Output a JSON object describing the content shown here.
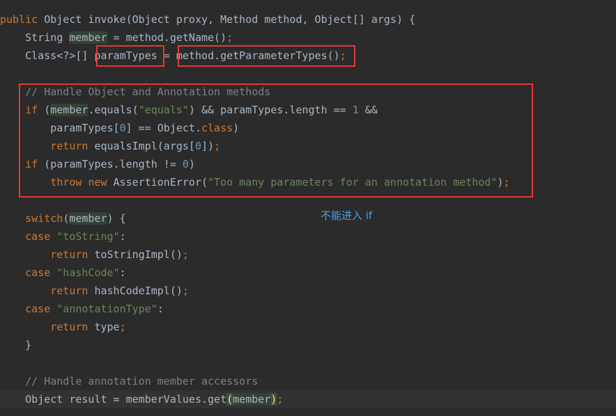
{
  "code": {
    "line1": {
      "kw": "public",
      "text": " Object invoke(Object proxy, Method method, Object[] args) {"
    },
    "line2": {
      "indent": "    ",
      "pre": "String ",
      "member": "member",
      "mid": " = method.getName()",
      "semi": ";"
    },
    "line3": {
      "indent": "    ",
      "pre": "Class<?>[] ",
      "var": "paramTypes",
      "eq": " = ",
      "call": "method.getParameterTypes()",
      "semi": ";"
    },
    "line5": {
      "indent": "    ",
      "comment": "// Handle Object and Annotation methods"
    },
    "line6": {
      "indent": "    ",
      "kw": "if",
      "open": " (",
      "member": "member",
      "call": ".equals(",
      "str": "\"equals\"",
      "rest": ") && paramTypes.length == ",
      "num": "1",
      "tail": " &&"
    },
    "line7": {
      "indent": "        ",
      "pre": "paramTypes[",
      "num": "0",
      "mid": "] == Object.",
      "kw": "class",
      "close": ")"
    },
    "line8": {
      "indent": "        ",
      "kw": "return",
      "mid": " equalsImpl(args[",
      "num": "0",
      "close": "])",
      "semi": ";"
    },
    "line9": {
      "indent": "    ",
      "kw": "if",
      "mid": " (paramTypes.length != ",
      "num": "0",
      "close": ")"
    },
    "line10": {
      "indent": "        ",
      "kw1": "throw",
      "sp": " ",
      "kw2": "new",
      "mid": " AssertionError(",
      "str": "\"Too many parameters for an annotation method\"",
      "close": ")",
      "semi": ";"
    },
    "line12": {
      "indent": "    ",
      "kw": "switch",
      "open": "(",
      "member": "member",
      "close": ") {"
    },
    "line13": {
      "indent": "    ",
      "kw": "case",
      "sp": " ",
      "str": "\"toString\"",
      "colon": ":"
    },
    "line14": {
      "indent": "        ",
      "kw": "return",
      "mid": " toStringImpl()",
      "semi": ";"
    },
    "line15": {
      "indent": "    ",
      "kw": "case",
      "sp": " ",
      "str": "\"hashCode\"",
      "colon": ":"
    },
    "line16": {
      "indent": "        ",
      "kw": "return",
      "mid": " hashCodeImpl()",
      "semi": ";"
    },
    "line17": {
      "indent": "    ",
      "kw": "case",
      "sp": " ",
      "str": "\"annotationType\"",
      "colon": ":"
    },
    "line18": {
      "indent": "        ",
      "kw": "return",
      "mid": " type",
      "semi": ";"
    },
    "line19": {
      "indent": "    ",
      "text": "}"
    },
    "line21": {
      "indent": "    ",
      "comment": "// Handle annotation member accessors"
    },
    "line22": {
      "indent": "    ",
      "pre": "Object result = memberValues.get",
      "po": "(",
      "member": "member",
      "pc": ")",
      "semi": ";"
    }
  },
  "annotation": {
    "note": "不能进入 if"
  },
  "colors": {
    "background": "#2b2b2b",
    "keyword": "#cc7832",
    "string": "#6a8759",
    "number": "#6897bb",
    "comment": "#808080",
    "box": "#e53935",
    "note": "#4a9fe8"
  }
}
